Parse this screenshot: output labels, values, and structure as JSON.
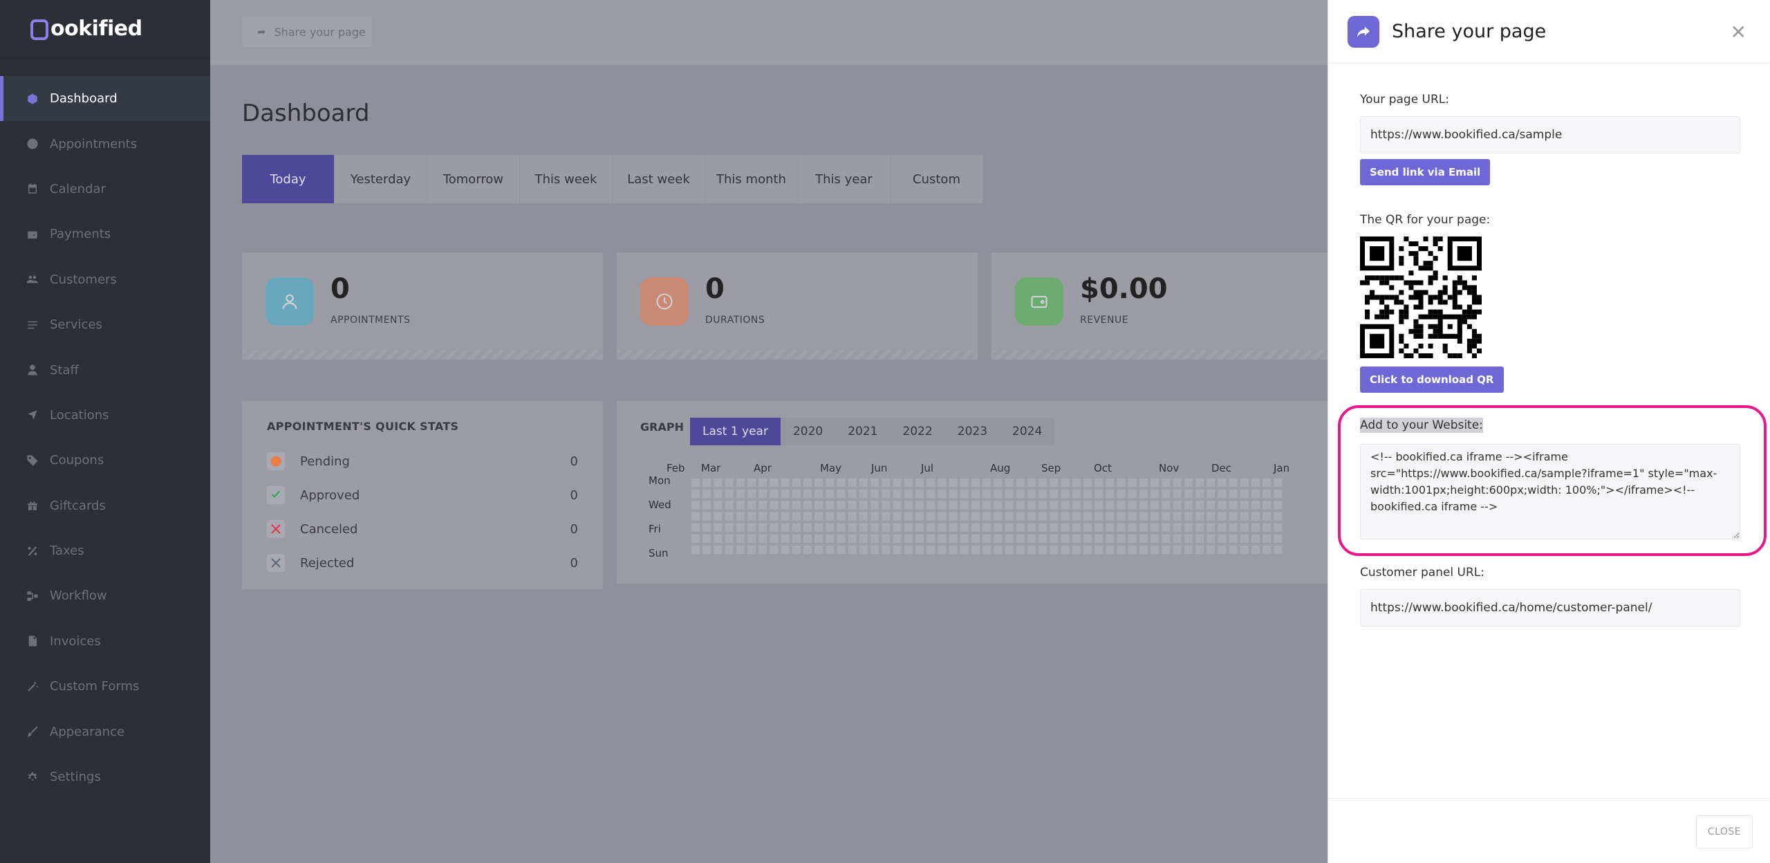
{
  "brand": {
    "name": "ookified",
    "mark": "b"
  },
  "sidebar": {
    "items": [
      {
        "label": "Dashboard",
        "icon": "cube-icon",
        "active": true
      },
      {
        "label": "Appointments",
        "icon": "clock-icon"
      },
      {
        "label": "Calendar",
        "icon": "calendar-icon"
      },
      {
        "label": "Payments",
        "icon": "wallet-icon"
      },
      {
        "label": "Customers",
        "icon": "users-icon"
      },
      {
        "label": "Services",
        "icon": "list-icon"
      },
      {
        "label": "Staff",
        "icon": "user-icon"
      },
      {
        "label": "Locations",
        "icon": "location-arrow-icon"
      },
      {
        "label": "Coupons",
        "icon": "tag-icon"
      },
      {
        "label": "Giftcards",
        "icon": "gift-icon"
      },
      {
        "label": "Taxes",
        "icon": "percent-icon"
      },
      {
        "label": "Workflow",
        "icon": "workflow-icon"
      },
      {
        "label": "Invoices",
        "icon": "file-icon"
      },
      {
        "label": "Custom Forms",
        "icon": "magic-wand-icon"
      },
      {
        "label": "Appearance",
        "icon": "brush-icon"
      },
      {
        "label": "Settings",
        "icon": "gear-icon"
      }
    ]
  },
  "topbar": {
    "share_label": "Share your page"
  },
  "dashboard": {
    "title": "Dashboard",
    "ranges": [
      "Today",
      "Yesterday",
      "Tomorrow",
      "This week",
      "Last week",
      "This month",
      "This year",
      "Custom"
    ],
    "active_range": "Today",
    "stats": [
      {
        "value": "0",
        "label": "APPOINTMENTS",
        "color": "#3fb0d0",
        "icon": "user-icon"
      },
      {
        "value": "0",
        "label": "DURATIONS",
        "color": "#ef7a4a",
        "icon": "clock-icon"
      },
      {
        "value": "$0.00",
        "label": "REVENUE",
        "color": "#49b949",
        "icon": "wallet-icon"
      }
    ],
    "quick_stats": {
      "title": "APPOINTMENT'S QUICK STATS",
      "rows": [
        {
          "label": "Pending",
          "count": "0",
          "icon": "clock-icon",
          "color": "#ef7a4a"
        },
        {
          "label": "Approved",
          "count": "0",
          "icon": "check-icon",
          "color": "#2fa84f"
        },
        {
          "label": "Canceled",
          "count": "0",
          "icon": "x-icon",
          "color": "#e5374e"
        },
        {
          "label": "Rejected",
          "count": "0",
          "icon": "x-icon",
          "color": "#5e6978"
        }
      ]
    },
    "graph": {
      "title": "GRAPH",
      "years": [
        "Last 1 year",
        "2020",
        "2021",
        "2022",
        "2023",
        "2024"
      ],
      "active_year": "Last 1 year",
      "months": [
        "Feb",
        "Mar",
        "Apr",
        "May",
        "Jun",
        "Jul",
        "Aug",
        "Sep",
        "Oct",
        "Nov",
        "Dec",
        "Jan"
      ],
      "days": [
        "Mon",
        "Wed",
        "Fri",
        "Sun"
      ]
    }
  },
  "panel": {
    "title": "Share your page",
    "page_url_label": "Your page URL:",
    "page_url": "https://www.bookified.ca/sample",
    "send_email_label": "Send link via Email",
    "qr_label": "The QR for your page:",
    "download_qr_label": "Click to download QR",
    "website_label": "Add to your Website:",
    "embed_code": "<!-- bookified.ca iframe --><iframe src=\"https://www.bookified.ca/sample?iframe=1\" style=\"max-width:1001px;height:600px;width: 100%;\"></iframe><!-- bookified.ca iframe -->",
    "customer_panel_label": "Customer panel URL:",
    "customer_panel_url": "https://www.bookified.ca/home/customer-panel/",
    "close_label": "CLOSE",
    "highlight_color": "#e5188c"
  }
}
